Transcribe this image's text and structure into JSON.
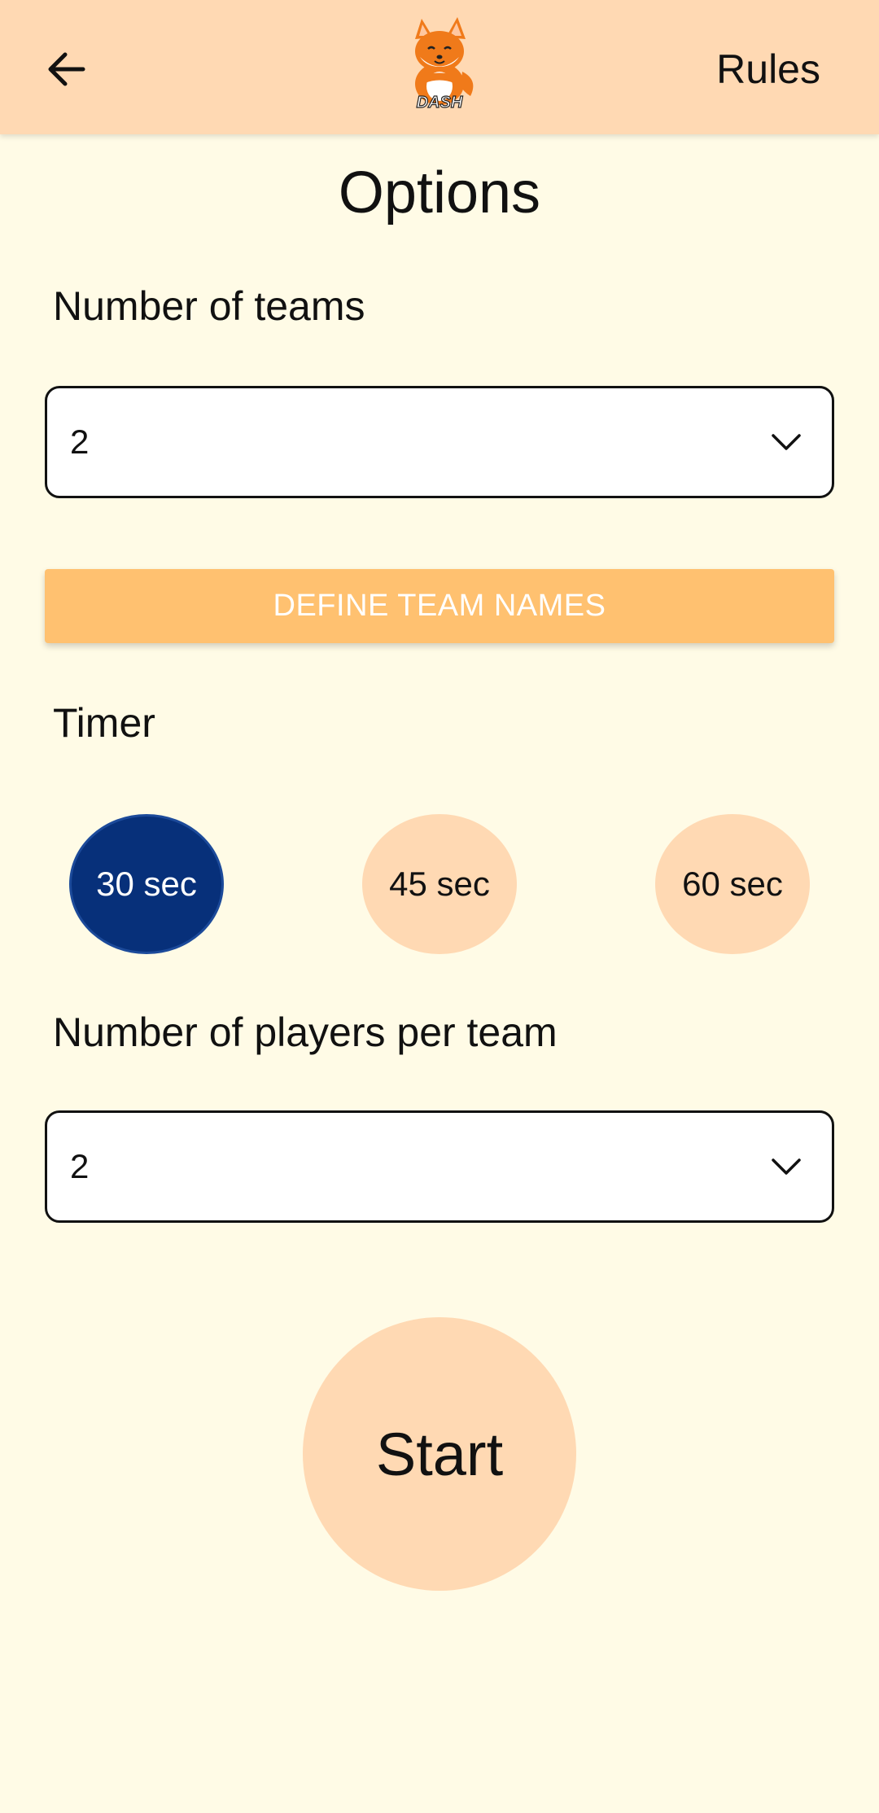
{
  "header": {
    "back_icon": "arrow-left-icon",
    "logo_text": "DASH",
    "rules_label": "Rules"
  },
  "page": {
    "title": "Options"
  },
  "teams": {
    "label": "Number of teams",
    "value": "2",
    "define_button": "DEFINE TEAM NAMES"
  },
  "timer": {
    "label": "Timer",
    "options": [
      "30 sec",
      "45 sec",
      "60 sec"
    ],
    "selected": "30 sec"
  },
  "players": {
    "label": "Number of players per team",
    "value": "2"
  },
  "start_label": "Start",
  "colors": {
    "header_bg": "#FFD9B3",
    "page_bg": "#FFFBE6",
    "accent_button": "#FFC170",
    "selected_timer": "#07307A"
  }
}
